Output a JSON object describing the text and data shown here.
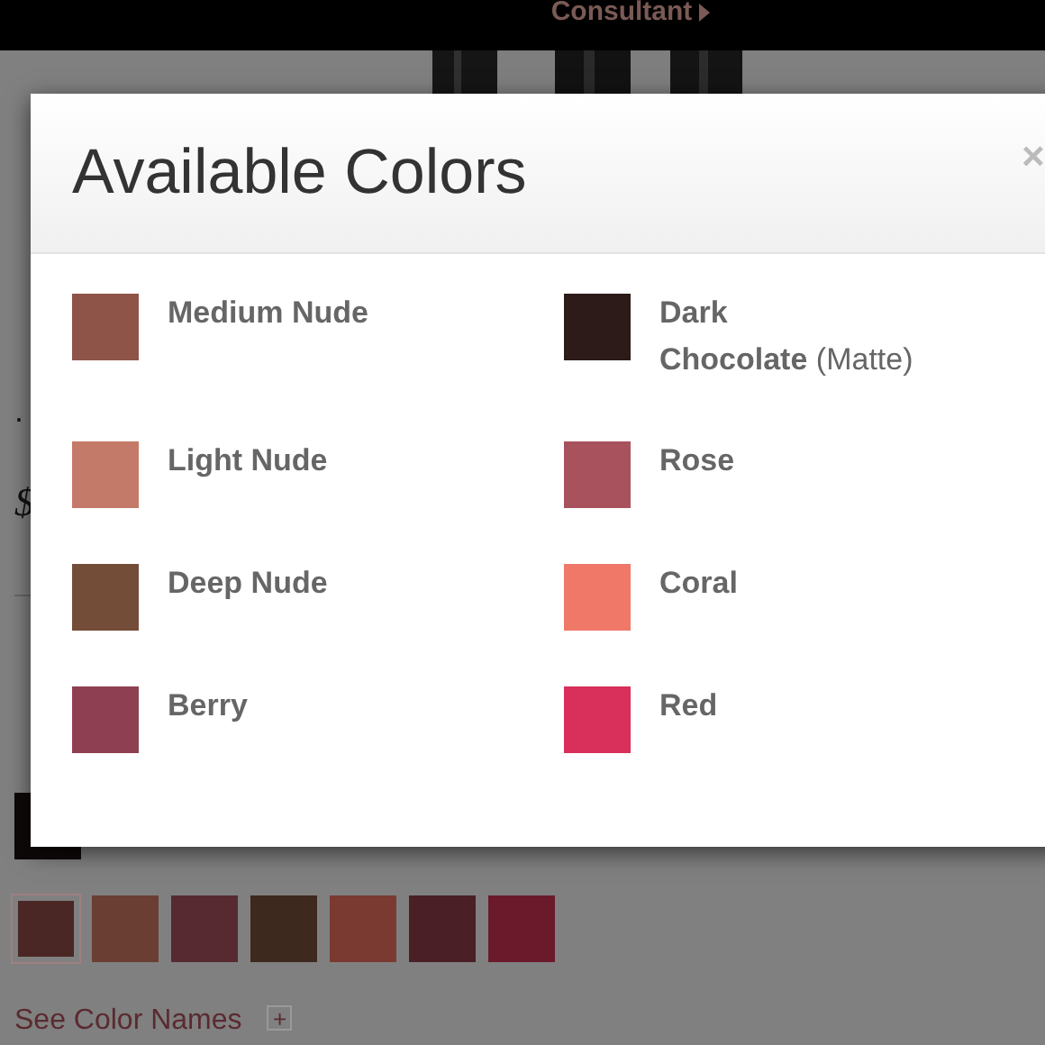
{
  "top_bar": {
    "link": "Consultant"
  },
  "background_page": {
    "fragments": [
      ".",
      "$"
    ],
    "shade_swatches": [
      {
        "color": "#4a2624",
        "selected": true
      },
      {
        "color": "#6a3e33",
        "selected": false
      },
      {
        "color": "#562a30",
        "selected": false
      },
      {
        "color": "#3d291e",
        "selected": false
      },
      {
        "color": "#7a3a32",
        "selected": false
      },
      {
        "color": "#4a1f26",
        "selected": false
      },
      {
        "color": "#6b1a2c",
        "selected": false
      }
    ],
    "see_color_names": "See Color Names",
    "expand": "+"
  },
  "modal": {
    "title": "Available Colors",
    "close": "×",
    "colors": [
      {
        "name": "Medium Nude",
        "color": "#8e5448"
      },
      {
        "name": "Dark Chocolate",
        "note": "(Matte)",
        "color": "#2c1b18"
      },
      {
        "name": "Light Nude",
        "color": "#c47a68"
      },
      {
        "name": "Rose",
        "color": "#a8525e"
      },
      {
        "name": "Deep Nude",
        "color": "#734d38"
      },
      {
        "name": "Coral",
        "color": "#f07868"
      },
      {
        "name": "Berry",
        "color": "#8e3f51"
      },
      {
        "name": "Red",
        "color": "#d8305a"
      }
    ]
  }
}
